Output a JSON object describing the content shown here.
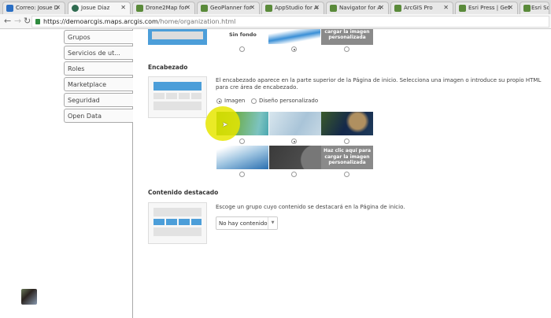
{
  "browser": {
    "tabs": [
      {
        "label": "Correo: Josue D",
        "active": false
      },
      {
        "label": "Josue Diaz",
        "active": true
      },
      {
        "label": "Drone2Map for",
        "active": false
      },
      {
        "label": "GeoPlanner for",
        "active": false
      },
      {
        "label": "AppStudio for A",
        "active": false
      },
      {
        "label": "Navigator for A",
        "active": false
      },
      {
        "label": "ArcGIS Pro",
        "active": false
      },
      {
        "label": "Esri Press | Get",
        "active": false
      },
      {
        "label": "Esri Sc",
        "active": false
      }
    ],
    "url_host": "https://demoarcgis.maps.arcgis.com",
    "url_path": "/home/organization.html"
  },
  "sidebar": {
    "items": [
      {
        "label": "Grupos"
      },
      {
        "label": "Servicios de ut..."
      },
      {
        "label": "Roles"
      },
      {
        "label": "Marketplace"
      },
      {
        "label": "Seguridad"
      },
      {
        "label": "Open Data"
      }
    ]
  },
  "background": {
    "no_bg_label": "Sin fondo",
    "custom_label": "Haz clic aquí para cargar la imagen personalizada",
    "selected_index": 1
  },
  "header": {
    "title": "Encabezado",
    "description": "El encabezado aparece en la parte superior de la Página de inicio. Selecciona una imagen o introduce su propio HTML para cre área de encabezado.",
    "mode_image": "Imagen",
    "mode_custom": "Diseño personalizado",
    "mode_selected": "Imagen",
    "custom_label": "Haz clic aquí para cargar la imagen personalizada",
    "selected_index": 1
  },
  "featured": {
    "title": "Contenido destacado",
    "description": "Escoge un grupo cuyo contenido se destacará en la Página de inicio.",
    "select_value": "No hay contenido destacado"
  },
  "colors": {
    "accent": "#4c9ed9"
  }
}
